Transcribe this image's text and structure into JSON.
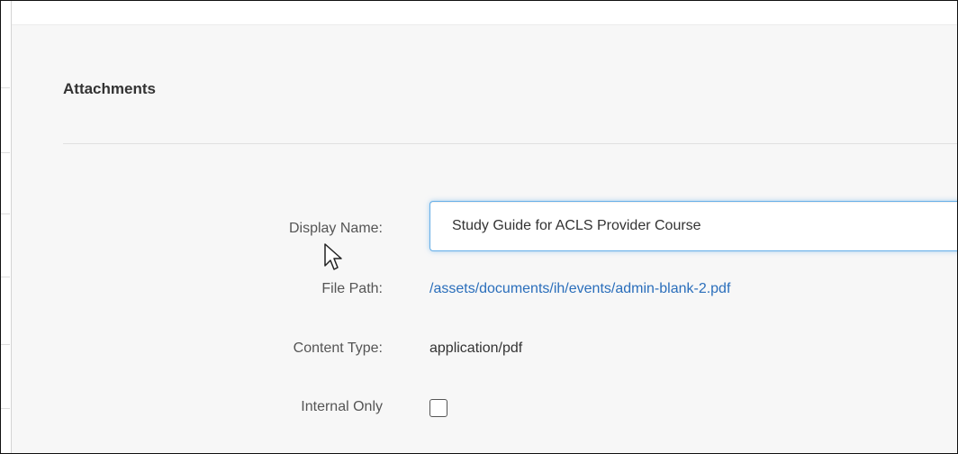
{
  "section": {
    "title": "Attachments"
  },
  "form": {
    "display_name": {
      "label": "Display Name:",
      "value": "Study Guide for ACLS Provider Course"
    },
    "file_path": {
      "label": "File Path:",
      "value": "/assets/documents/ih/events/admin-blank-2.pdf"
    },
    "content_type": {
      "label": "Content Type:",
      "value": "application/pdf"
    },
    "internal_only": {
      "label": "Internal Only",
      "checked": false
    }
  },
  "colors": {
    "link": "#2a6ebb",
    "input_focus_border": "#66afe9",
    "panel_background": "#f7f7f7",
    "label_text": "#555555"
  },
  "icons": {
    "pointer": "mouse-pointer-icon"
  }
}
